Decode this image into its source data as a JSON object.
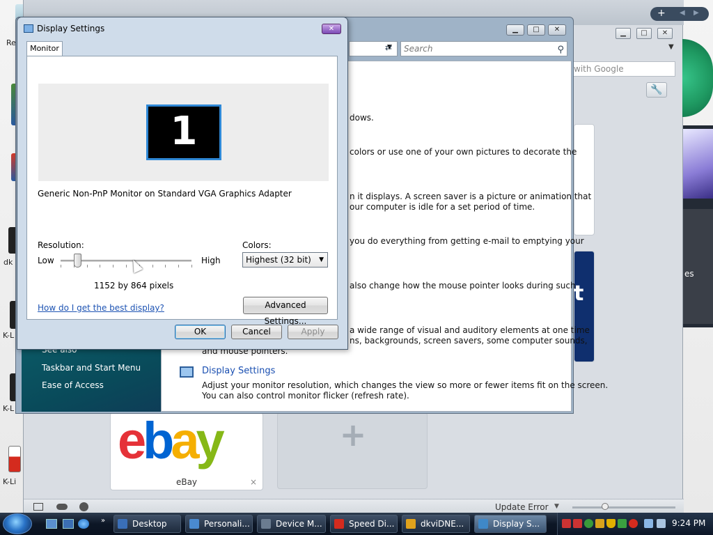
{
  "desktop": {
    "labels": [
      "Re",
      "dk",
      "K-L",
      "K-L",
      "K-Li"
    ]
  },
  "browser": {
    "google_placeholder": "with Google",
    "ebay": {
      "logo": "ebay",
      "label": "eBay",
      "close": "×"
    },
    "add_tile": "+",
    "status": "Update Error",
    "right_text": "es",
    "gauge_label": ""
  },
  "personalization": {
    "search_placeholder": "Search",
    "lines": [
      "dows.",
      "colors or use one of your own pictures to decorate the",
      "n it displays. A screen saver is a picture or animation that",
      "our computer is idle for a set period of time.",
      "you do everything from getting e-mail to emptying your",
      "also change how the mouse pointer looks during such",
      "a wide range of visual and auditory elements at one time",
      "ns, backgrounds, screen savers, some computer sounds,",
      "and mouse pointers."
    ],
    "display_settings_link": "Display Settings",
    "display_settings_desc1": "Adjust your monitor resolution, which changes the view so more or fewer items fit on the screen.",
    "display_settings_desc2": "You can also control monitor flicker (refresh rate).",
    "sidebar": {
      "see_also": "See also",
      "items": [
        "Taskbar and Start Menu",
        "Ease of Access"
      ]
    }
  },
  "dialog": {
    "title": "Display Settings",
    "tab": "Monitor",
    "monitor_number": "1",
    "monitor_name": "Generic Non-PnP Monitor on Standard VGA Graphics Adapter",
    "resolution_label": "Resolution:",
    "low": "Low",
    "high": "High",
    "resolution_value": "1152 by 864 pixels",
    "resolution_slider_position": 0.15,
    "colors_label": "Colors:",
    "colors_value": "Highest (32 bit)",
    "help_link": "How do I get the best display?",
    "advanced_button": "Advanced Settings...",
    "ok": "OK",
    "cancel": "Cancel",
    "apply": "Apply"
  },
  "taskbar": {
    "tasks": [
      {
        "label": "Desktop",
        "icon_color": "#3a6fb8",
        "active": false
      },
      {
        "label": "Personali...",
        "icon_color": "#4a8ad0",
        "active": false
      },
      {
        "label": "Device M...",
        "icon_color": "#6b7c90",
        "active": false
      },
      {
        "label": "Speed Di...",
        "icon_color": "#d42b1e",
        "active": false
      },
      {
        "label": "dkviDNE...",
        "icon_color": "#e0a21c",
        "active": false
      },
      {
        "label": "Display S...",
        "icon_color": "#3f88c8",
        "active": true
      }
    ],
    "clock": "9:24 PM"
  }
}
